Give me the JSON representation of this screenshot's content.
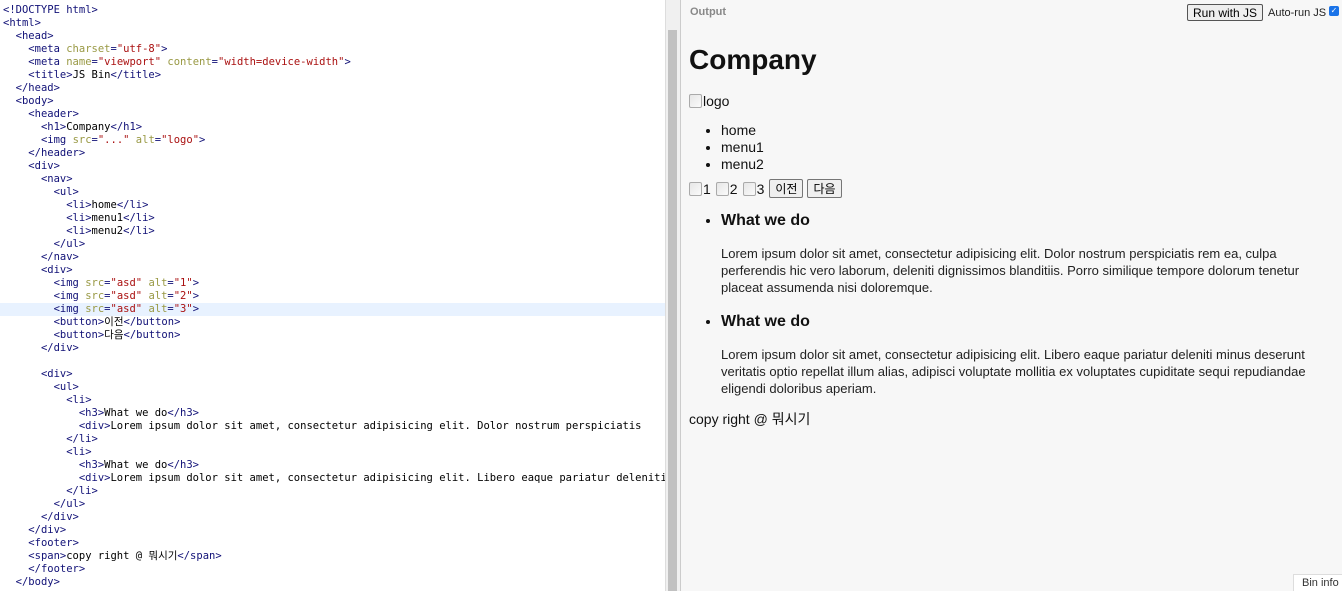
{
  "editor": {
    "lines": [
      "<!DOCTYPE html>",
      "<html>",
      "  <head>",
      "    <meta charset=\"utf-8\">",
      "    <meta name=\"viewport\" content=\"width=device-width\">",
      "    <title>JS Bin</title>",
      "  </head>",
      "  <body>",
      "    <header>",
      "      <h1>Company</h1>",
      "      <img src=\"...\" alt=\"logo\">",
      "    </header>",
      "    <div>",
      "      <nav>",
      "        <ul>",
      "          <li>home</li>",
      "          <li>menu1</li>",
      "          <li>menu2</li>",
      "        </ul>",
      "      </nav>",
      "      <div>",
      "        <img src=\"asd\" alt=\"1\">",
      "        <img src=\"asd\" alt=\"2\">",
      "        <img src=\"asd\" alt=\"3\">",
      "        <button>이전</button>",
      "        <button>다음</button>",
      "      </div>",
      "",
      "      <div>",
      "        <ul>",
      "          <li>",
      "            <h3>What we do</h3>",
      "            <div>Lorem ipsum dolor sit amet, consectetur adipisicing elit. Dolor nostrum perspiciatis",
      "          </li>",
      "          <li>",
      "            <h3>What we do</h3>",
      "            <div>Lorem ipsum dolor sit amet, consectetur adipisicing elit. Libero eaque pariatur deleniti",
      "          </li>",
      "        </ul>",
      "      </div>",
      "    </div>",
      "    <footer>",
      "    <span>copy right @ 뭐시기</span>",
      "    </footer>",
      "  </body>"
    ],
    "active_line": 23
  },
  "output": {
    "title": "Output",
    "run_button": "Run with JS",
    "autorun_label": "Auto-run JS",
    "autorun_checked": true,
    "page": {
      "heading": "Company",
      "logo_alt": "logo",
      "nav": [
        "home",
        "menu1",
        "menu2"
      ],
      "slides": [
        "1",
        "2",
        "3"
      ],
      "prev_button": "이전",
      "next_button": "다음",
      "items": [
        {
          "title": "What we do",
          "text": "Lorem ipsum dolor sit amet, consectetur adipisicing elit. Dolor nostrum perspiciatis rem ea, culpa perferendis hic vero laborum, deleniti dignissimos blanditiis. Porro similique tempore dolorum tenetur placeat assumenda nisi doloremque."
        },
        {
          "title": "What we do",
          "text": "Lorem ipsum dolor sit amet, consectetur adipisicing elit. Libero eaque pariatur deleniti minus deserunt veritatis optio repellat illum alias, adipisci voluptate mollitia ex voluptates cupiditate sequi repudiandae eligendi doloribus aperiam."
        }
      ],
      "footer": "copy right @ 뭐시기"
    },
    "info_tab": "Bin info"
  }
}
